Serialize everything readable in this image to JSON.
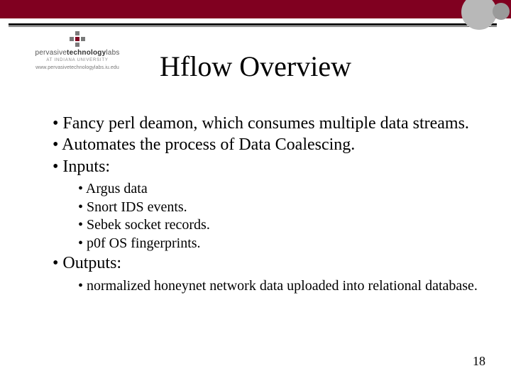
{
  "logo": {
    "line1_a": "pervasive",
    "line1_b": "technology",
    "line1_c": "labs",
    "sub": "AT INDIANA UNIVERSITY",
    "url": "www.pervasivetechnologylabs.iu.edu"
  },
  "title": "Hflow Overview",
  "bullets": {
    "b1": "Fancy perl deamon, which consumes multiple data streams.",
    "b2": "Automates the process of Data Coalescing.",
    "b3": "Inputs:",
    "b3_sub": {
      "s1": "Argus data",
      "s2": "Snort IDS events.",
      "s3": "Sebek socket records.",
      "s4": "p0f OS fingerprints."
    },
    "b4": "Outputs:",
    "b4_sub": {
      "s1": "normalized honeynet network data uploaded into relational database."
    }
  },
  "page_number": "18"
}
